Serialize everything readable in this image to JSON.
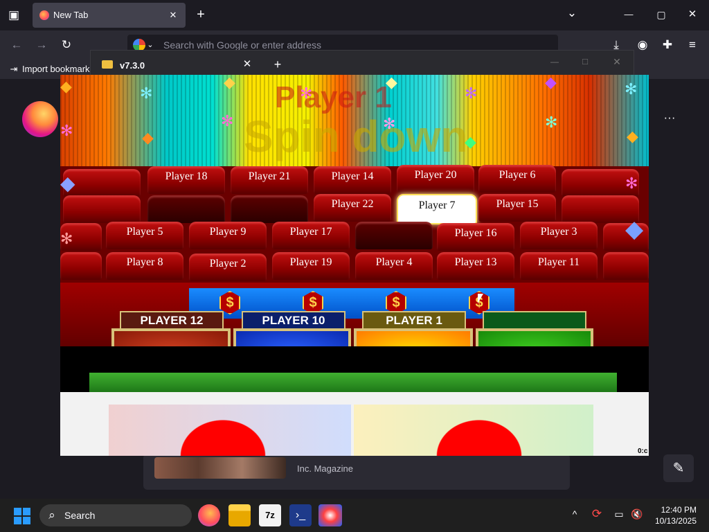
{
  "browser": {
    "tab_title": "New Tab",
    "address_placeholder": "Search with Google or enter address",
    "bookmark_import": "Import bookmarks",
    "tab_close": "✕",
    "new_tab": "+",
    "tab_list": "⌄",
    "min": "—",
    "max": "▢",
    "close": "✕",
    "back": "←",
    "forward": "→",
    "reload": "↻",
    "downloads": "⤓",
    "account": "◉",
    "extensions": "✚",
    "menu": "≡",
    "more": "···"
  },
  "newtab": {
    "story_source": "Inc. Magazine",
    "edit": "✎"
  },
  "app_window": {
    "title": "v7.3.0",
    "close": "✕",
    "add": "+",
    "min": "—",
    "max": "□",
    "win_close": "✕"
  },
  "game": {
    "title_line1": "Player 1",
    "title_line2": "Spin down",
    "seats_row1": [
      "Player 18",
      "Player 21",
      "Player 14",
      "Player 20",
      "Player 6"
    ],
    "seats_row2": [
      "Player 22",
      "Player 7",
      "Player 15"
    ],
    "seats_row3": [
      "Player 5",
      "Player 9",
      "Player 17",
      "Player 16",
      "Player 3"
    ],
    "seats_row4": [
      "Player 8",
      "Player 2",
      "Player 19",
      "Player 4",
      "Player 13",
      "Player 11"
    ],
    "highlighted_seat": "Player 7",
    "dollar_sign": "$",
    "podiums": [
      {
        "label": "PLAYER 12",
        "label_color": "#5a1a10",
        "box_color": "#b02a10"
      },
      {
        "label": "PLAYER 10",
        "label_color": "#0b1f6b",
        "box_color": "#1040e8"
      },
      {
        "label": "PLAYER 1",
        "label_color": "#6a5a10",
        "box_color": "#f0a000"
      },
      {
        "label": "",
        "label_color": "#0b5a1a",
        "box_color": "#2aa41a"
      }
    ],
    "corner_text": "0:c"
  },
  "taskbar": {
    "search_label": "Search",
    "time": "12:40 PM",
    "date": "10/13/2025",
    "chevron": "^"
  },
  "colors": {
    "bg": "#1c1b22",
    "seat_red": "#c31010",
    "gold": "#d8c27a",
    "taskbar": "#1f1f1f"
  }
}
